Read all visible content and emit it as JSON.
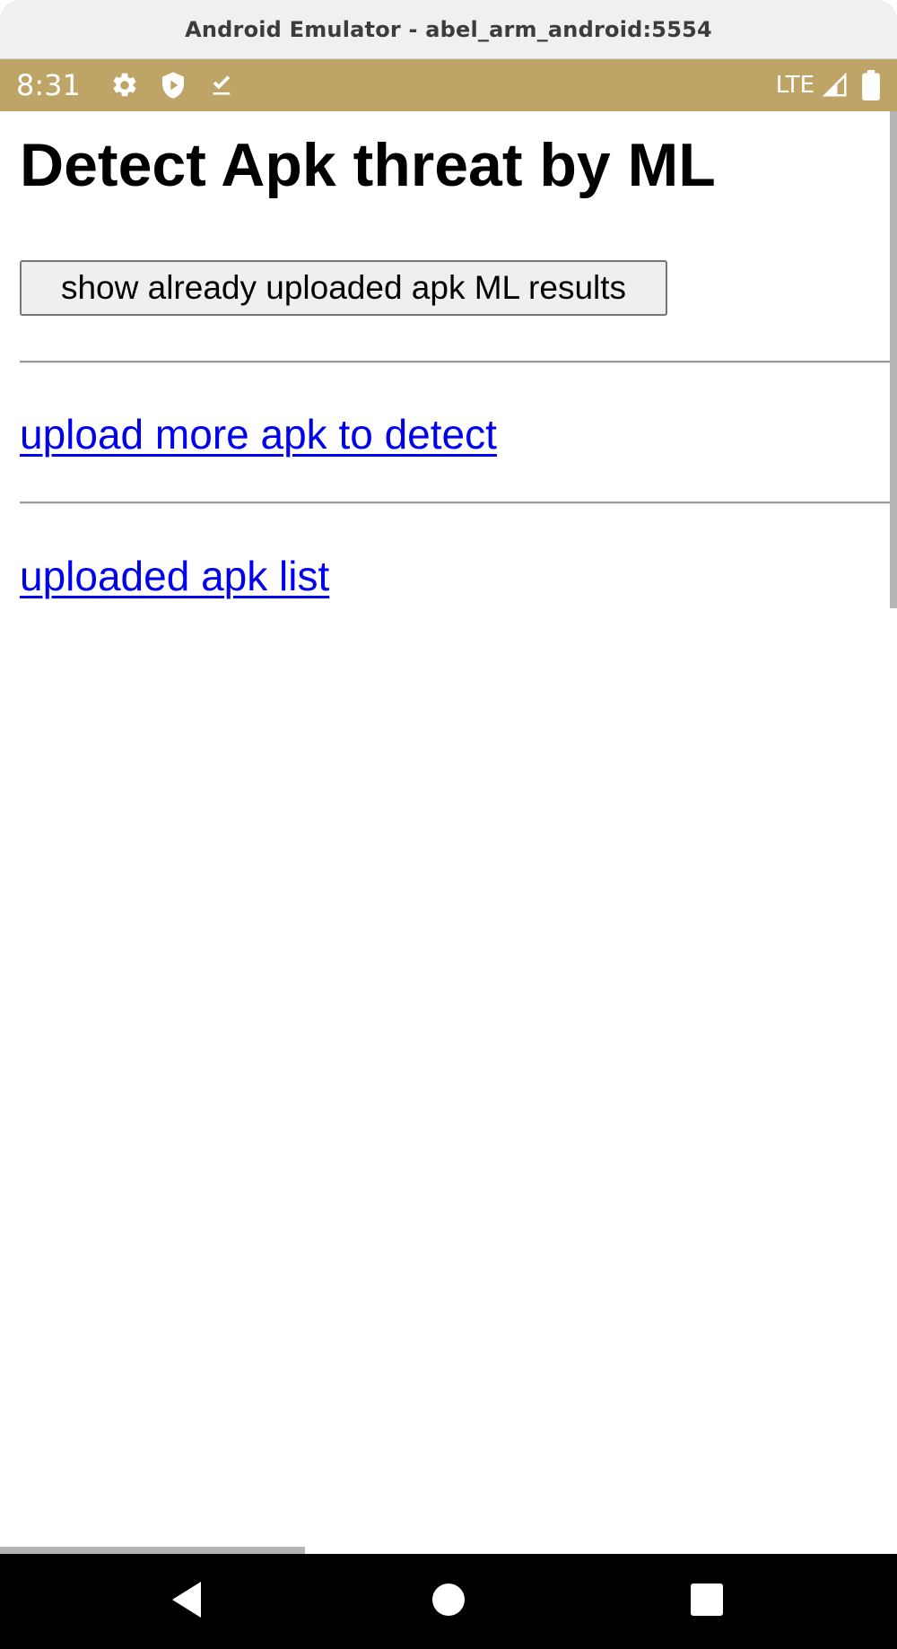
{
  "window": {
    "title": "Android Emulator - abel_arm_android:5554"
  },
  "status_bar": {
    "time": "8:31",
    "network": "LTE",
    "background_color": "#bfa468",
    "icons": [
      "gear-icon",
      "shield-play-icon",
      "download-done-icon",
      "signal-icon",
      "battery-icon"
    ]
  },
  "page": {
    "title": "Detect Apk threat by ML",
    "results_button_label": "show already uploaded apk ML results",
    "upload_link": "upload more apk to detect",
    "list_link": "uploaded apk list",
    "link_color": "#0000ee"
  },
  "nav_bar": {
    "icons": [
      "back-icon",
      "home-icon",
      "recents-icon"
    ]
  }
}
